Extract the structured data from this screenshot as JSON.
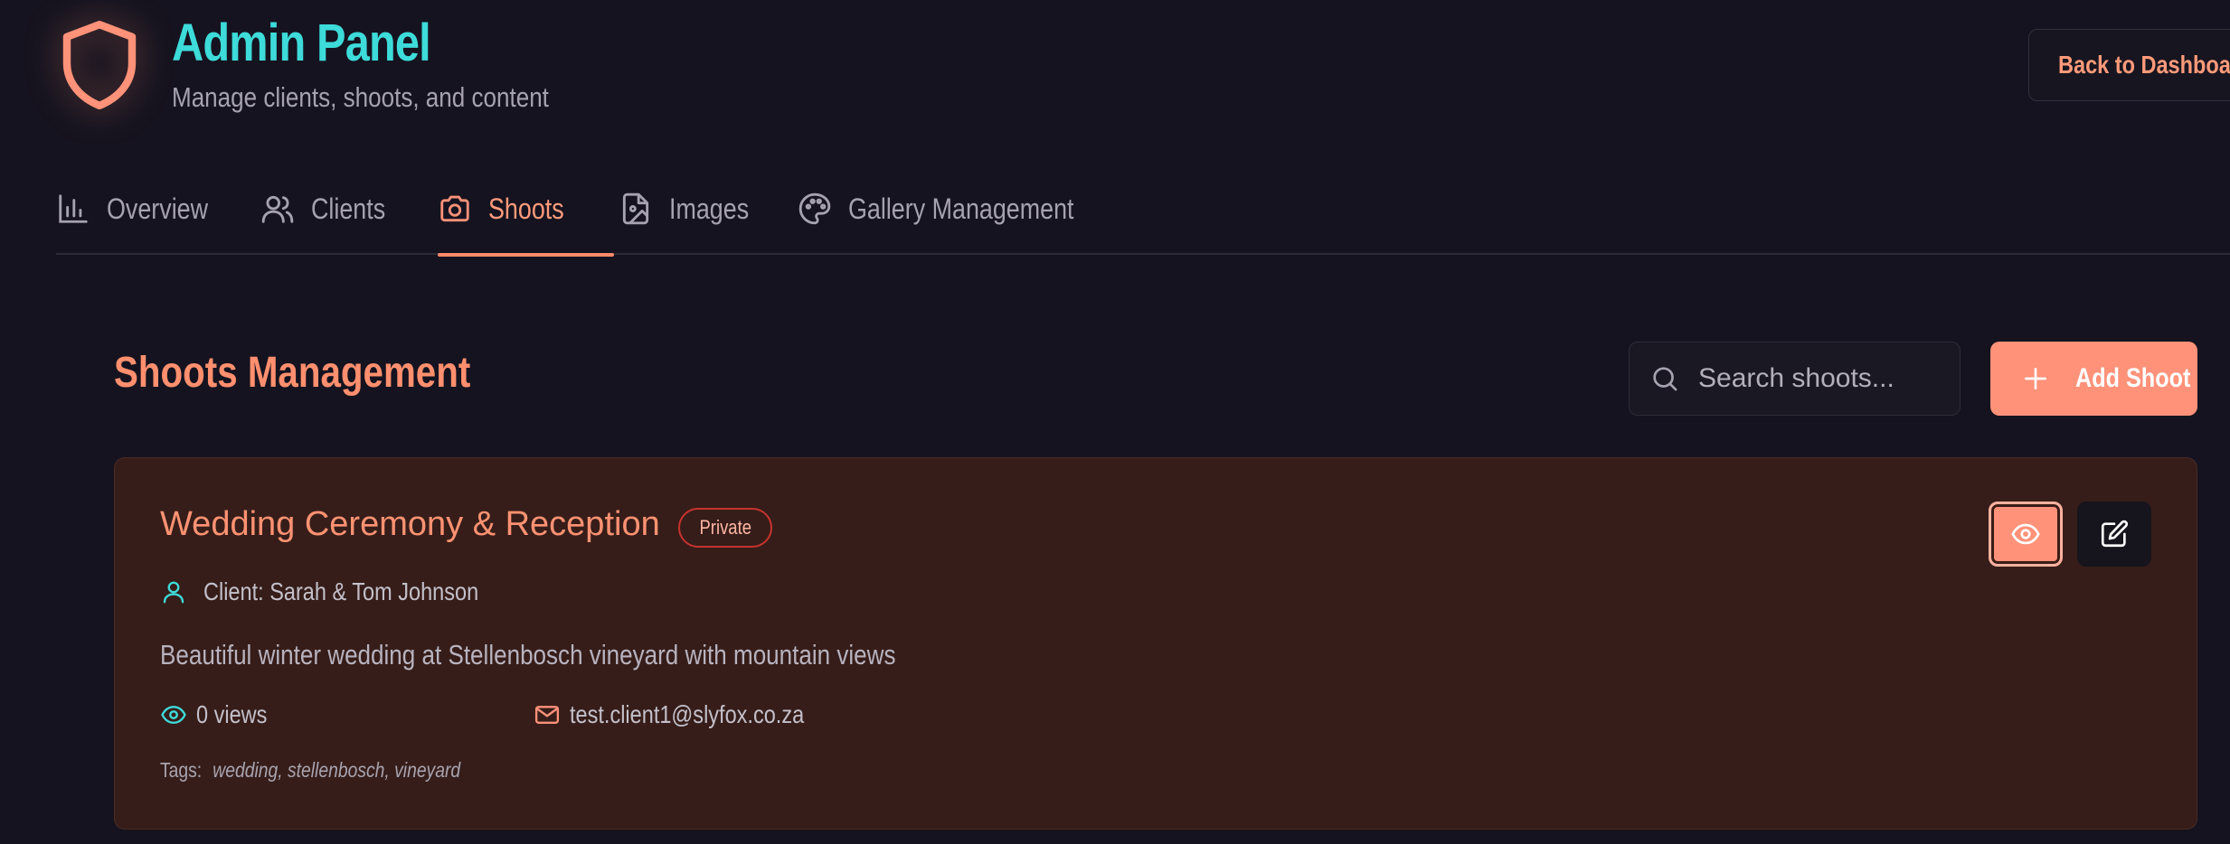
{
  "header": {
    "title": "Admin Panel",
    "subtitle": "Manage clients, shoots, and content",
    "back_button": "Back to Dashboard",
    "logo_icon": "shield-icon"
  },
  "tabs": [
    {
      "label": "Overview",
      "icon": "bar-chart-icon",
      "active": false
    },
    {
      "label": "Clients",
      "icon": "users-icon",
      "active": false
    },
    {
      "label": "Shoots",
      "icon": "camera-icon",
      "active": true
    },
    {
      "label": "Images",
      "icon": "image-file-icon",
      "active": false
    },
    {
      "label": "Gallery Management",
      "icon": "palette-icon",
      "active": false
    }
  ],
  "section": {
    "title": "Shoots Management",
    "search_placeholder": "Search shoots...",
    "add_button": "Add Shoot"
  },
  "shoots": [
    {
      "title": "Wedding Ceremony & Reception",
      "badge": "Private",
      "client": "Client: Sarah & Tom Johnson",
      "description": "Beautiful winter wedding at Stellenbosch vineyard with mountain views",
      "views": "0 views",
      "email": "test.client1@slyfox.co.za",
      "tags_label": "Tags:",
      "tags": "wedding, stellenbosch, vineyard"
    }
  ],
  "colors": {
    "background": "#15131f",
    "accent": "#ff9279",
    "title_teal": "#3ddbd9",
    "card_bg": "#361d19",
    "badge_border": "#c7332e"
  }
}
